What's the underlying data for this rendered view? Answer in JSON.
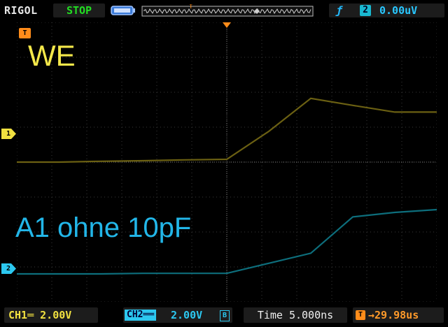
{
  "header": {
    "brand": "RIGOL",
    "run_state": "STOP",
    "trigger_slope": "ƒ",
    "trigger_source": "2",
    "trigger_level": "0.00uV"
  },
  "markers": {
    "trigger_tag": "T",
    "ch1_tag": "1",
    "ch2_tag": "2"
  },
  "annotations": {
    "ch1_label": "WE",
    "ch2_label": "A1 ohne 10pF"
  },
  "footer": {
    "ch1_scale": "CH1═  2.00V",
    "ch2_tag": "CH2══",
    "ch2_scale": "2.00V",
    "ch2_bw": "B",
    "timebase": "Time 5.000ns",
    "delay_icon": "T",
    "delay": "→29.98us"
  },
  "colors": {
    "ch1": "#6b6012",
    "ch2": "#0d6e7c",
    "grid": "#3a3a3a",
    "trigger": "#ff8c1a"
  },
  "chart_data": {
    "type": "line",
    "x": [
      -5,
      -4,
      -3,
      -2,
      -1,
      0,
      1,
      2,
      3,
      4,
      5
    ],
    "xlabel": "",
    "ylabel": "",
    "series": [
      {
        "values": [
          0.0,
          0.0,
          0.03,
          0.05,
          0.08,
          0.1,
          1.1,
          2.28,
          2.03,
          1.79,
          1.79
        ]
      },
      {
        "values": [
          -4.0,
          -4.0,
          -4.0,
          -3.98,
          -3.98,
          -3.98,
          -3.62,
          -3.26,
          -1.96,
          -1.8,
          -1.7
        ]
      }
    ],
    "xlim": [
      -5,
      5
    ],
    "ylim": [
      -5,
      5
    ],
    "grid": true
  }
}
